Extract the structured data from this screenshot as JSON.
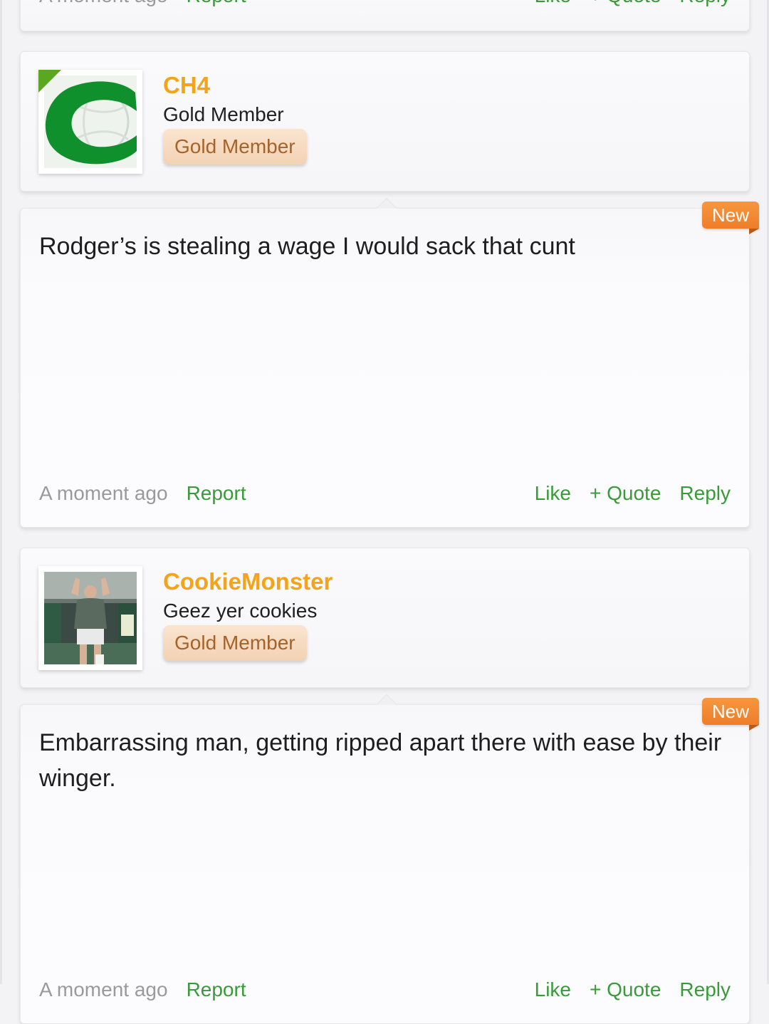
{
  "colors": {
    "username": "#f5a31a",
    "link": "#3a9a3a",
    "timestamp": "#9a9a9a",
    "rank_badge_bg": "#f5d9bf",
    "rank_badge_text": "#a4632a",
    "new_badge": "#f08a33",
    "online_indicator": "#5aa821"
  },
  "top_footer": {
    "time": "A moment ago",
    "report": "Report",
    "like": "Like",
    "quote": "+ Quote",
    "reply": "Reply"
  },
  "posts": [
    {
      "username": "CH4",
      "user_title": "Gold Member",
      "rank": "Gold Member",
      "avatar_icon": "celtic-logo-avatar",
      "online": true,
      "new_label": "New",
      "message": "Rodger’s is stealing a wage I would sack that cunt",
      "footer": {
        "time": "A moment ago",
        "report": "Report",
        "like": "Like",
        "quote": "+ Quote",
        "reply": "Reply"
      }
    },
    {
      "username": "CookieMonster",
      "user_title": "Geez yer cookies",
      "rank": "Gold Member",
      "avatar_icon": "player-photo-avatar",
      "online": false,
      "new_label": "New",
      "message": "Embarrassing man, getting ripped apart there with ease by their winger.",
      "footer": {
        "time": "A moment ago",
        "report": "Report",
        "like": "Like",
        "quote": "+ Quote",
        "reply": "Reply"
      }
    }
  ]
}
